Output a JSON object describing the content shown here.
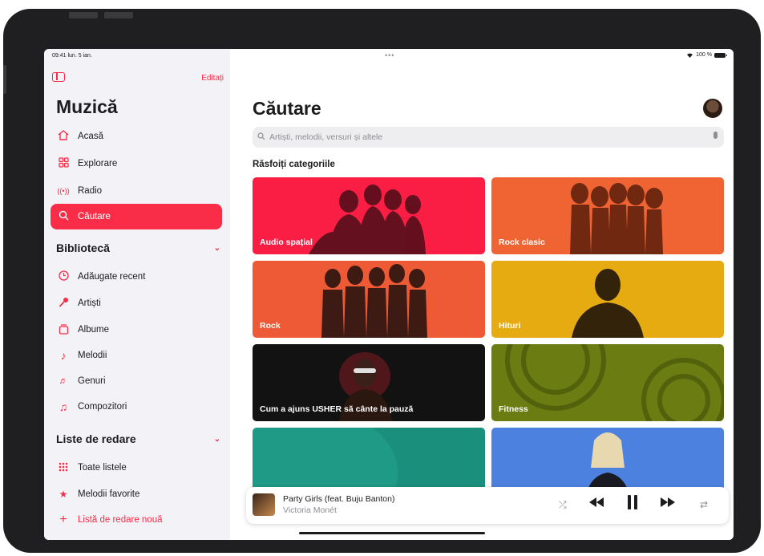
{
  "status": {
    "time": "09:41",
    "date": "lun. 5 ian.",
    "dots": "•••",
    "battery": "100 %"
  },
  "sidebar": {
    "edit_label": "Editați",
    "app_title": "Muzică",
    "nav": [
      {
        "label": "Acasă",
        "icon": "home-icon"
      },
      {
        "label": "Explorare",
        "icon": "grid-icon"
      },
      {
        "label": "Radio",
        "icon": "radio-icon"
      },
      {
        "label": "Căutare",
        "icon": "search-icon",
        "active": true
      }
    ],
    "library_title": "Bibliotecă",
    "library": [
      {
        "label": "Adăugate recent",
        "icon": "clock-icon"
      },
      {
        "label": "Artiști",
        "icon": "microphone-icon"
      },
      {
        "label": "Albume",
        "icon": "album-icon"
      },
      {
        "label": "Melodii",
        "icon": "note-icon"
      },
      {
        "label": "Genuri",
        "icon": "genres-icon"
      },
      {
        "label": "Compozitori",
        "icon": "composer-icon"
      }
    ],
    "playlists_title": "Liste de redare",
    "playlists": [
      {
        "label": "Toate listele",
        "icon": "playlists-grid-icon"
      },
      {
        "label": "Melodii favorite",
        "icon": "star-icon"
      },
      {
        "label": "Listă de redare nouă",
        "icon": "plus-icon"
      }
    ]
  },
  "main": {
    "title": "Căutare",
    "search_placeholder": "Artiști, melodii, versuri și altele",
    "browse_heading": "Răsfoiți categoriile",
    "categories": [
      {
        "label": "Audio spațial",
        "color": "#fa1e45"
      },
      {
        "label": "Rock clasic",
        "color": "#f06434"
      },
      {
        "label": "Rock",
        "color": "#ee5a36"
      },
      {
        "label": "Hituri",
        "color": "#e6ab10"
      },
      {
        "label": "Cum a ajuns USHER să cânte la pauză",
        "color": "#121212"
      },
      {
        "label": "Fitness",
        "color": "#6b7c12"
      },
      {
        "label": "",
        "color": "#1e9a86"
      },
      {
        "label": "",
        "color": "#4d81e0"
      }
    ]
  },
  "player": {
    "title": "Party Girls (feat. Buju Banton)",
    "artist": "Victoria Monét",
    "controls": {
      "shuffle": "shuffle-icon",
      "previous": "previous-icon",
      "pause": "pause-icon",
      "next": "next-icon",
      "repeat": "repeat-icon"
    }
  },
  "colors": {
    "accent": "#fa2d48",
    "sidebar_bg": "#f2f2f7",
    "bezel": "#1f1f21"
  }
}
